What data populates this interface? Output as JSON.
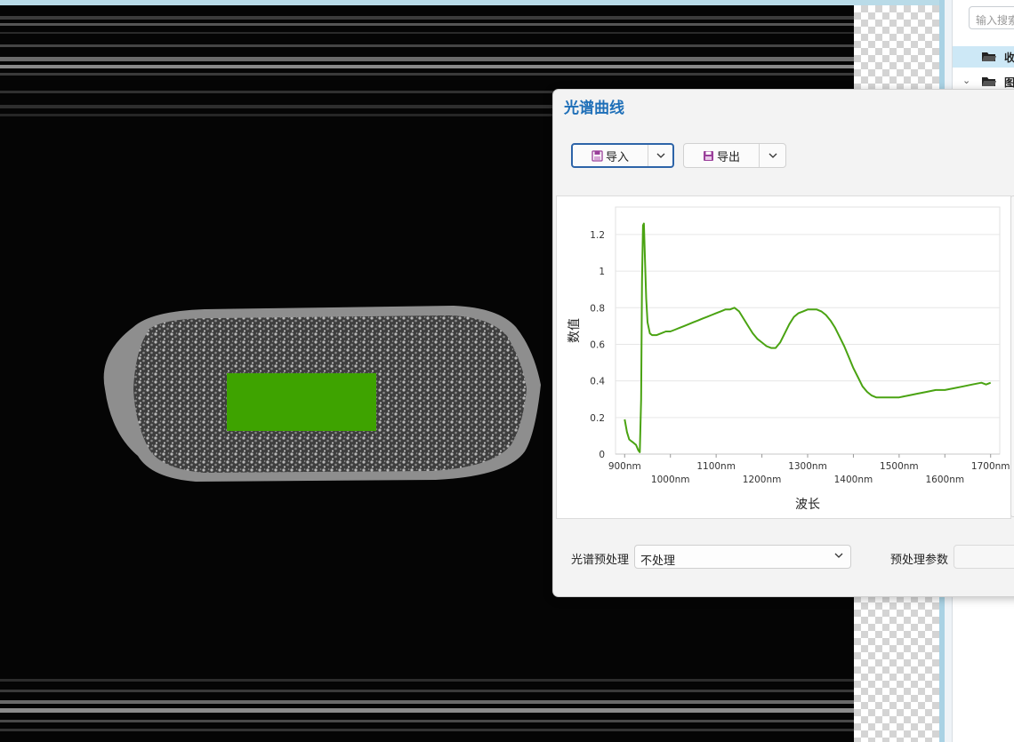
{
  "dialog": {
    "title": "光谱曲线",
    "import_label": "导入",
    "export_label": "导出",
    "preprocess_label": "光谱预处理",
    "preprocess_value": "不处理",
    "param_label": "预处理参数",
    "param_value": ""
  },
  "right_panel": {
    "search_placeholder": "输入搜索",
    "tree": [
      {
        "label": "收",
        "expanded": false,
        "selected": true,
        "icon": "folder-icon"
      },
      {
        "label": "图",
        "expanded": true,
        "selected": false,
        "icon": "folder-icon"
      }
    ]
  },
  "viewer": {
    "roi_color": "#3ea300"
  },
  "colors": {
    "accent": "#1e6fb8",
    "series": "#4aa312",
    "selection": "#cde8f6"
  },
  "chart_data": {
    "type": "line",
    "title": "",
    "xlabel": "波长",
    "ylabel": "数值",
    "xlim": [
      880,
      1720
    ],
    "ylim": [
      0,
      1.35
    ],
    "x_ticks": [
      900,
      1000,
      1100,
      1200,
      1300,
      1400,
      1500,
      1600,
      1700
    ],
    "x_tick_labels": [
      "900nm",
      "1000nm",
      "1100nm",
      "1200nm",
      "1300nm",
      "1400nm",
      "1500nm",
      "1600nm",
      "1700nm"
    ],
    "y_ticks": [
      0,
      0.2,
      0.4,
      0.6,
      0.8,
      1.0,
      1.2
    ],
    "y_tick_labels": [
      "0",
      "0.2",
      "0.4",
      "0.6",
      "0.8",
      "1",
      "1.2"
    ],
    "grid": true,
    "legend": false,
    "series": [
      {
        "x": [
          900,
          905,
          910,
          915,
          920,
          925,
          930,
          933,
          936,
          938,
          940,
          942,
          944,
          947,
          950,
          955,
          960,
          970,
          980,
          990,
          1000,
          1010,
          1020,
          1030,
          1040,
          1050,
          1060,
          1070,
          1080,
          1090,
          1100,
          1110,
          1120,
          1130,
          1140,
          1150,
          1160,
          1170,
          1180,
          1190,
          1200,
          1210,
          1220,
          1230,
          1240,
          1250,
          1260,
          1270,
          1280,
          1290,
          1300,
          1310,
          1320,
          1330,
          1340,
          1350,
          1360,
          1370,
          1380,
          1390,
          1400,
          1410,
          1420,
          1430,
          1440,
          1450,
          1460,
          1480,
          1500,
          1520,
          1540,
          1560,
          1580,
          1600,
          1620,
          1640,
          1660,
          1680,
          1690,
          1700
        ],
        "values": [
          0.19,
          0.12,
          0.08,
          0.07,
          0.06,
          0.05,
          0.02,
          0.01,
          0.3,
          0.95,
          1.25,
          1.26,
          1.1,
          0.85,
          0.72,
          0.66,
          0.65,
          0.65,
          0.66,
          0.67,
          0.67,
          0.68,
          0.69,
          0.7,
          0.71,
          0.72,
          0.73,
          0.74,
          0.75,
          0.76,
          0.77,
          0.78,
          0.79,
          0.79,
          0.8,
          0.78,
          0.74,
          0.7,
          0.66,
          0.63,
          0.61,
          0.59,
          0.58,
          0.58,
          0.61,
          0.66,
          0.71,
          0.75,
          0.77,
          0.78,
          0.79,
          0.79,
          0.79,
          0.78,
          0.76,
          0.73,
          0.69,
          0.64,
          0.59,
          0.53,
          0.47,
          0.42,
          0.37,
          0.34,
          0.32,
          0.31,
          0.31,
          0.31,
          0.31,
          0.32,
          0.33,
          0.34,
          0.35,
          0.35,
          0.36,
          0.37,
          0.38,
          0.39,
          0.38,
          0.39
        ]
      }
    ]
  }
}
